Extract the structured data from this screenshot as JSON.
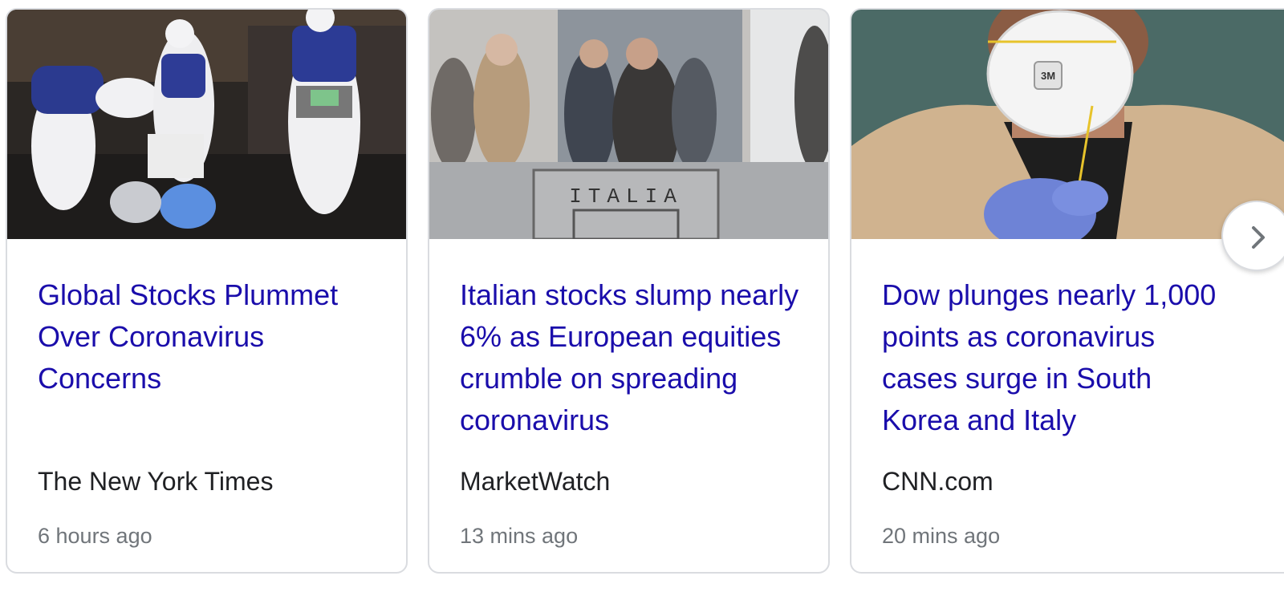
{
  "news_carousel": {
    "articles": [
      {
        "headline": "Global Stocks Plummet Over Coronavirus Concerns",
        "source": "The New York Times",
        "time": "6 hours ago",
        "thumbnail": "hazmat-workers-photo"
      },
      {
        "headline": "Italian stocks slump nearly 6% as European equities crumble on spreading coronavirus",
        "source": "MarketWatch",
        "time": "13 mins ago",
        "thumbnail": "masked-crowd-italia-sign-photo"
      },
      {
        "headline": "Dow plunges nearly 1,000 points as coronavirus cases surge in South Korea and Italy",
        "source": "CNN.com",
        "time": "20 mins ago",
        "thumbnail": "man-in-3m-mask-photo"
      }
    ],
    "next_button_icon": "chevron-right-icon",
    "colors": {
      "headline": "#1a0dab",
      "source": "#202124",
      "time": "#70757a",
      "border": "#dadce0"
    }
  }
}
